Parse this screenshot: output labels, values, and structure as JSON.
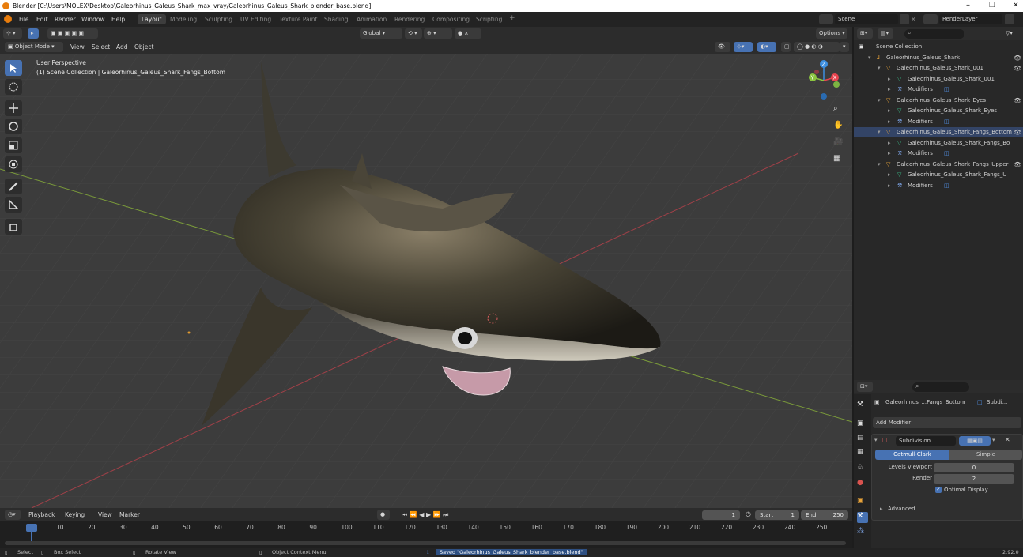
{
  "window": {
    "title": "Blender [C:\\Users\\MOLEX\\Desktop\\Galeorhinus_Galeus_Shark_max_vray/Galeorhinus_Galeus_Shark_blender_base.blend]",
    "minimize": "–",
    "restore": "❐",
    "close": "✕"
  },
  "menubar": {
    "items": [
      "File",
      "Edit",
      "Render",
      "Window",
      "Help"
    ],
    "workspaces": [
      "Layout",
      "Modeling",
      "Sculpting",
      "UV Editing",
      "Texture Paint",
      "Shading",
      "Animation",
      "Rendering",
      "Compositing",
      "Scripting"
    ],
    "add_tab": "+",
    "scene": "Scene",
    "render_layer": "RenderLayer"
  },
  "viewport": {
    "transform_orientation": "Global",
    "options": "Options",
    "mode": "Object Mode",
    "menus": [
      "View",
      "Select",
      "Add",
      "Object"
    ],
    "perspective": "User Perspective",
    "collection_info": "(1) Scene Collection | Galeorhinus_Galeus_Shark_Fangs_Bottom",
    "gizmo": {
      "x": "X",
      "y": "Y",
      "z": "Z"
    },
    "colors": {
      "x": "#e8444f",
      "y": "#8bc53f",
      "z": "#3d8fe0",
      "bg": "#3c3c3c"
    }
  },
  "outliner": {
    "search_placeholder": "",
    "rows": [
      {
        "label": "Scene Collection",
        "icon": "collection-icon"
      },
      {
        "label": "Galeorhinus_Galeus_Shark",
        "icon": "empty-icon"
      },
      {
        "label": "Galeorhinus_Galeus_Shark_001",
        "icon": "mesh-object-icon"
      },
      {
        "label": "Galeorhinus_Galeus_Shark_001",
        "icon": "mesh-data-icon"
      },
      {
        "label": "Modifiers",
        "icon": "wrench-icon"
      },
      {
        "label": "Galeorhinus_Galeus_Shark_Eyes",
        "icon": "mesh-object-icon"
      },
      {
        "label": "Galeorhinus_Galeus_Shark_Eyes",
        "icon": "mesh-data-icon"
      },
      {
        "label": "Modifiers",
        "icon": "wrench-icon"
      },
      {
        "label": "Galeorhinus_Galeus_Shark_Fangs_Bottom",
        "icon": "mesh-object-icon"
      },
      {
        "label": "Galeorhinus_Galeus_Shark_Fangs_Bo",
        "icon": "mesh-data-icon"
      },
      {
        "label": "Modifiers",
        "icon": "wrench-icon"
      },
      {
        "label": "Galeorhinus_Galeus_Shark_Fangs_Upper",
        "icon": "mesh-object-icon"
      },
      {
        "label": "Galeorhinus_Galeus_Shark_Fangs_U",
        "icon": "mesh-data-icon"
      },
      {
        "label": "Modifiers",
        "icon": "wrench-icon"
      }
    ]
  },
  "properties": {
    "object_name": "Galeorhinus_...Fangs_Bottom",
    "modifier_short": "Subdi...",
    "add_modifier": "Add Modifier",
    "modifier_name": "Subdivision",
    "catmull": "Catmull-Clark",
    "simple": "Simple",
    "levels_viewport_label": "Levels Viewport",
    "levels_viewport_value": "0",
    "render_label": "Render",
    "render_value": "2",
    "optimal_display": "Optimal Display",
    "advanced": "Advanced"
  },
  "timeline": {
    "menus": [
      "Playback",
      "Keying",
      "View",
      "Marker"
    ],
    "current_frame": "1",
    "start_label": "Start",
    "start_value": "1",
    "end_label": "End",
    "end_value": "250",
    "ticks": [
      "1",
      "10",
      "20",
      "30",
      "40",
      "50",
      "60",
      "70",
      "80",
      "90",
      "100",
      "110",
      "120",
      "130",
      "140",
      "150",
      "160",
      "170",
      "180",
      "190",
      "200",
      "210",
      "220",
      "230",
      "240",
      "250"
    ]
  },
  "statusbar": {
    "select": "Select",
    "box_select": "Box Select",
    "rotate_view": "Rotate View",
    "context_menu": "Object Context Menu",
    "message": "Saved \"Galeorhinus_Galeus_Shark_blender_base.blend\"",
    "version": "2.92.0"
  }
}
